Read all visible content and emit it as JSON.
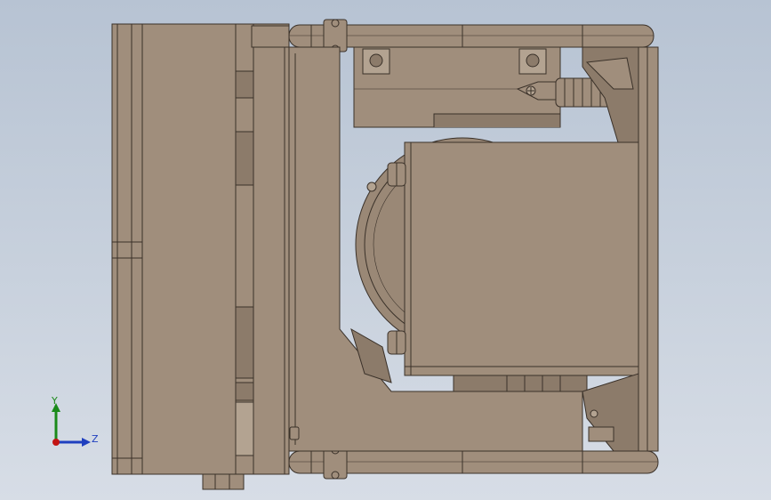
{
  "viewport": {
    "background_top": "#b7c3d3",
    "background_bottom": "#d7dde6"
  },
  "model": {
    "body_color": "#a08e7c",
    "edge_color": "#3a3129",
    "shade_color": "#8c7b6a",
    "light_color": "#b3a391"
  },
  "triad": {
    "y_label": "Y",
    "z_label": "Z",
    "y_color": "#1a8a1a",
    "z_color": "#1f3fbf",
    "origin_color": "#c21414"
  }
}
